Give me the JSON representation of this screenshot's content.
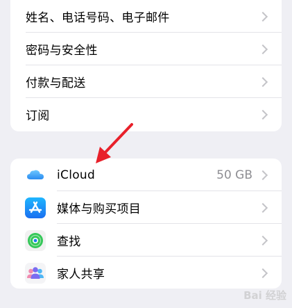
{
  "account_group": {
    "items": [
      {
        "label": "姓名、电话号码、电子邮件"
      },
      {
        "label": "密码与安全性"
      },
      {
        "label": "付款与配送"
      },
      {
        "label": "订阅"
      }
    ]
  },
  "services_group": {
    "items": [
      {
        "label": "iCloud",
        "detail": "50 GB",
        "icon": "icloud-icon"
      },
      {
        "label": "媒体与购买项目",
        "icon": "app-store-icon"
      },
      {
        "label": "查找",
        "icon": "find-my-icon"
      },
      {
        "label": "家人共享",
        "icon": "family-sharing-icon"
      }
    ]
  },
  "watermark": "Bai 经验",
  "colors": {
    "background": "#efeff4",
    "annotation_arrow": "#e8202a",
    "chevron": "#c4c4c8",
    "detail_text": "#8e8e93"
  }
}
